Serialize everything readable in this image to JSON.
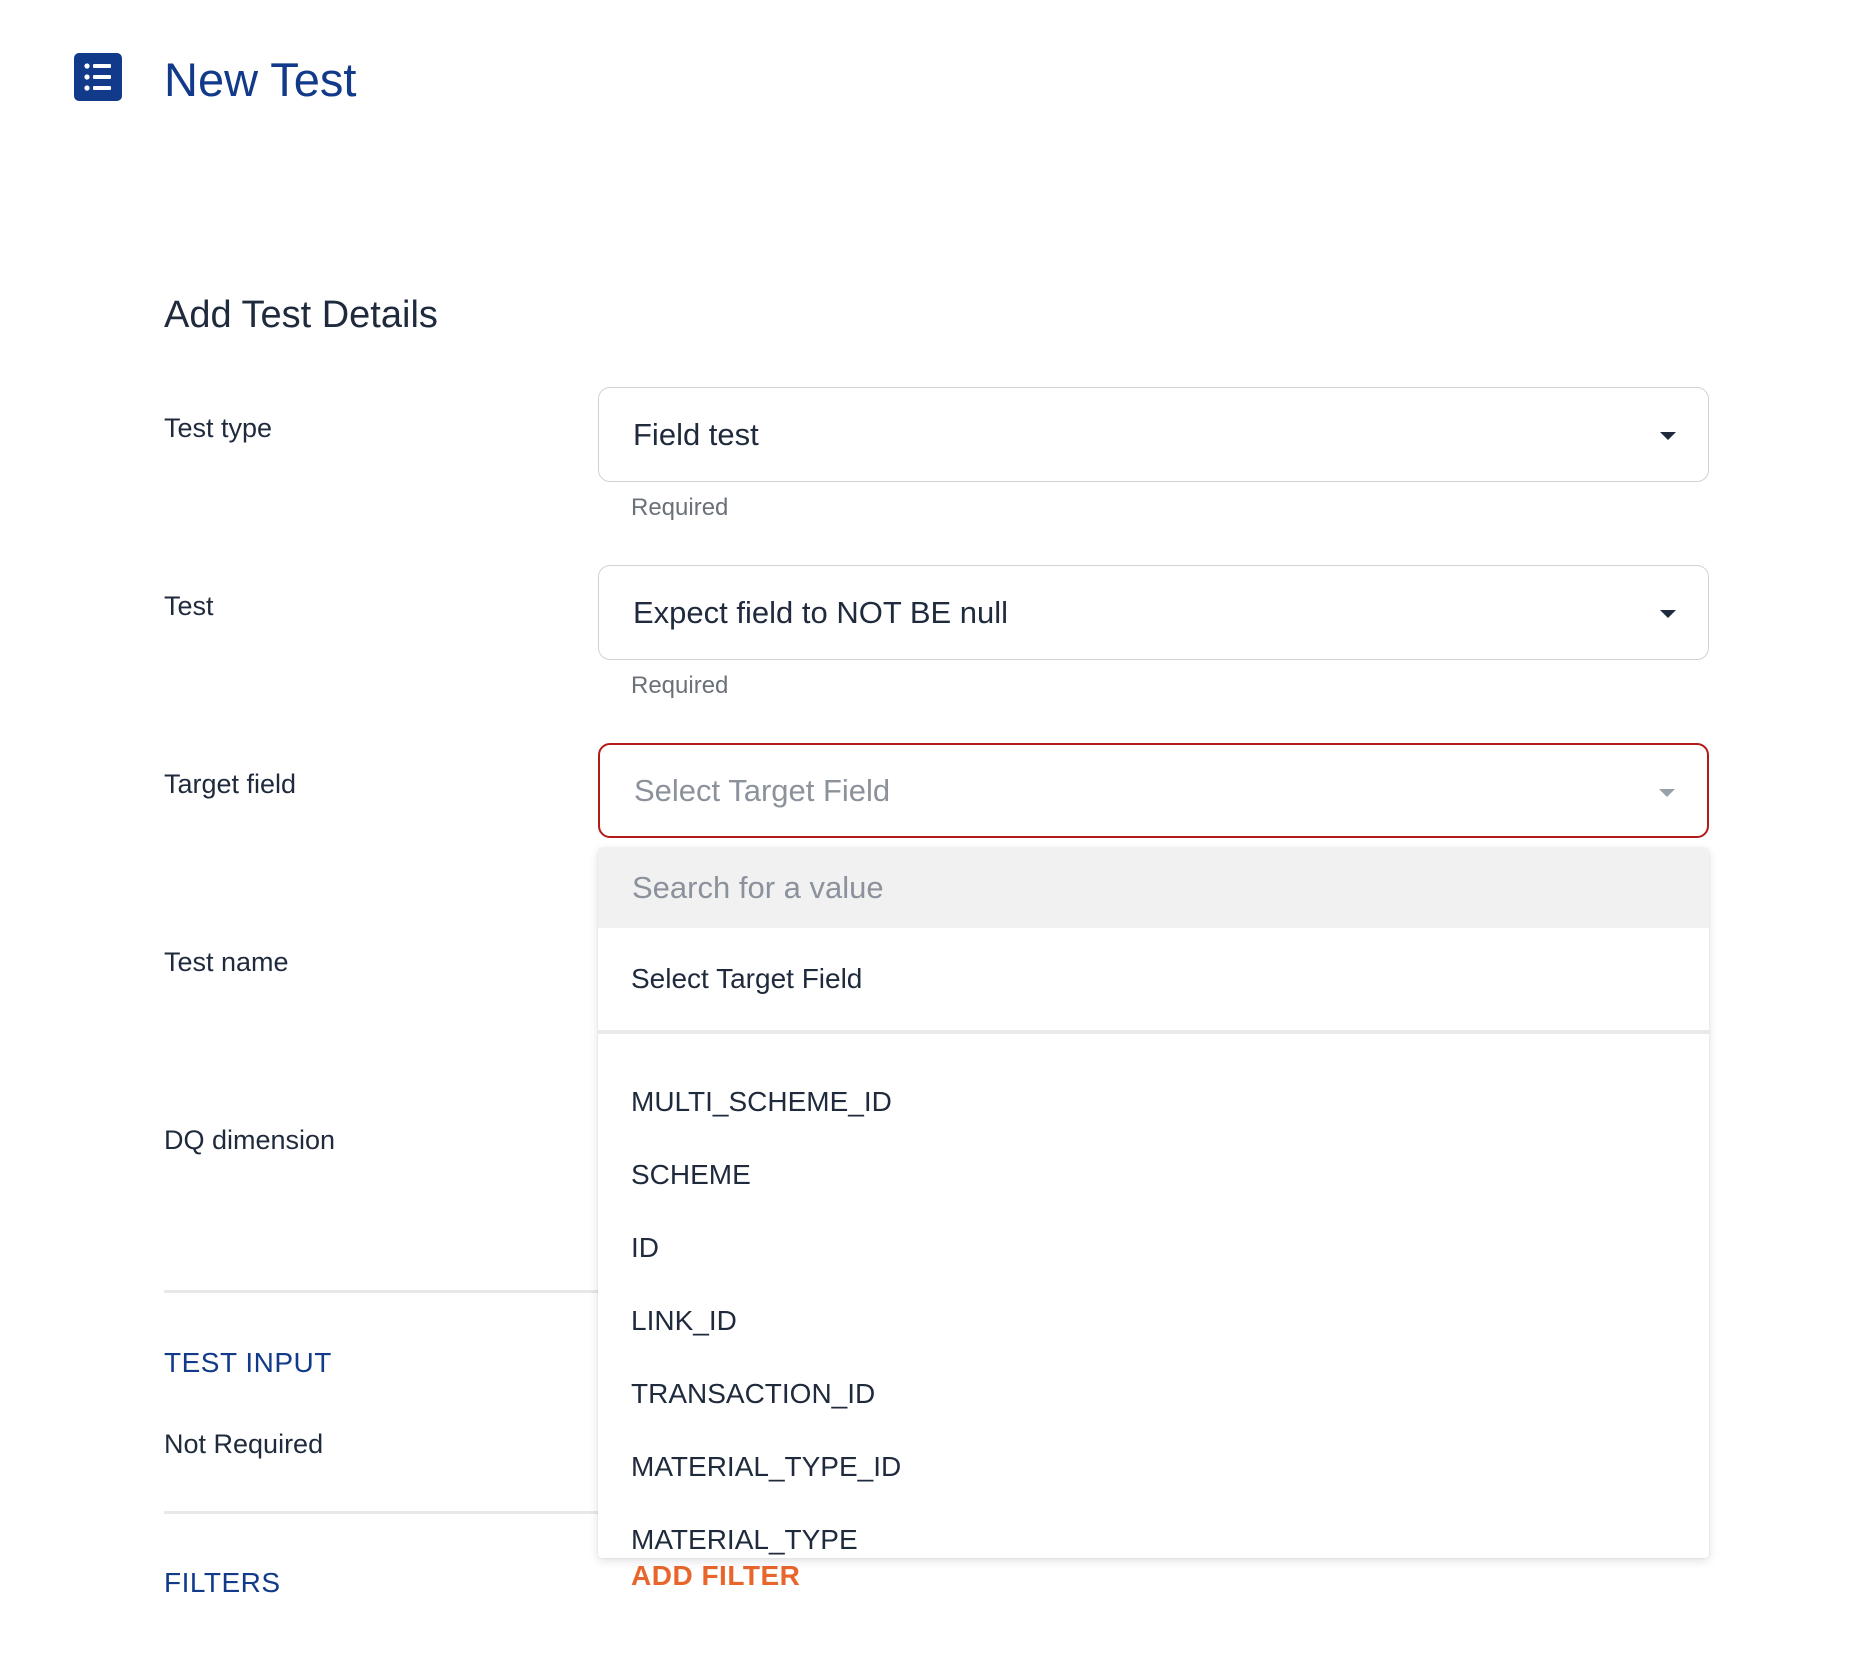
{
  "header": {
    "icon": "list-icon",
    "title": "New Test"
  },
  "form": {
    "section_title": "Add Test Details",
    "test_type": {
      "label": "Test type",
      "value": "Field test",
      "helper": "Required"
    },
    "test": {
      "label": "Test",
      "value": "Expect field to NOT BE null",
      "helper": "Required"
    },
    "target_field": {
      "label": "Target field",
      "placeholder": "Select Target Field"
    },
    "test_name": {
      "label": "Test name"
    },
    "dq_dimension": {
      "label": "DQ dimension"
    },
    "test_input": {
      "section_label": "TEST INPUT",
      "value": "Not Required"
    },
    "filters": {
      "section_label": "FILTERS",
      "add_label": "ADD FILTER"
    }
  },
  "dropdown": {
    "search_placeholder": "Search for a value",
    "default_option": "Select Target Field",
    "options": [
      "MULTI_SCHEME_ID",
      "SCHEME",
      "ID",
      "LINK_ID",
      "TRANSACTION_ID",
      "MATERIAL_TYPE_ID",
      "MATERIAL_TYPE"
    ]
  },
  "colors": {
    "brand": "#123a8a",
    "accent": "#e8652b",
    "error": "#b31a1a"
  }
}
